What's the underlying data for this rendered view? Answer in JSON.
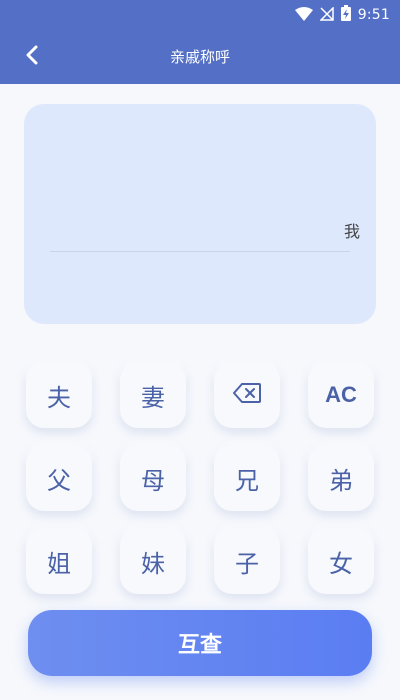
{
  "status_bar": {
    "time": "9:51",
    "icons": [
      "wifi-icon",
      "signal-off-icon",
      "battery-charging-icon"
    ]
  },
  "header": {
    "title": "亲戚称呼",
    "back_icon": "chevron-left-icon"
  },
  "display": {
    "result": "我"
  },
  "keypad": {
    "rows": [
      [
        "夫",
        "妻",
        "⌫",
        "AC"
      ],
      [
        "父",
        "母",
        "兄",
        "弟"
      ],
      [
        "姐",
        "妹",
        "子",
        "女"
      ]
    ],
    "backspace_icon": "backspace-icon"
  },
  "actions": {
    "query_label": "互查"
  },
  "colors": {
    "accent": "#5470c6",
    "key_text": "#4b62a8",
    "display_bg": "#dde8fc",
    "button_gradient_start": "#6e8ef0",
    "button_gradient_end": "#5a7df2"
  }
}
